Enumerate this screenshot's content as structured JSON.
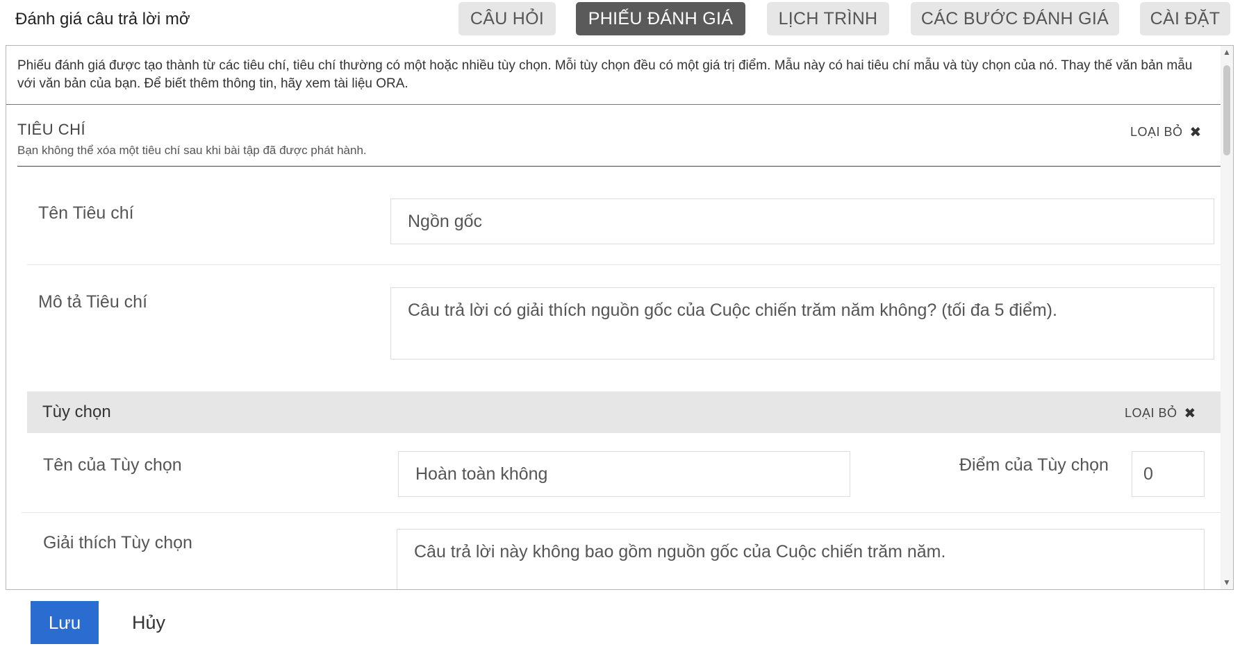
{
  "header": {
    "title": "Đánh giá câu trả lời mở",
    "tabs": [
      {
        "label": "CÂU HỎI",
        "active": false
      },
      {
        "label": "PHIẾU ĐÁNH GIÁ",
        "active": true
      },
      {
        "label": "LỊCH TRÌNH",
        "active": false
      },
      {
        "label": "CÁC BƯỚC ĐÁNH GIÁ",
        "active": false
      },
      {
        "label": "CÀI ĐẶT",
        "active": false
      }
    ]
  },
  "rubric": {
    "intro": "Phiếu đánh giá được tạo thành từ các tiêu chí, tiêu chí thường có một hoặc nhiều tùy chọn. Mỗi tùy chọn đều có một giá trị điểm. Mẫu này có hai tiêu chí mẫu và tùy chọn của nó. Thay thế văn bản mẫu với văn bản của bạn. Để biết thêm thông tin, hãy xem tài liệu ORA.",
    "criterion": {
      "heading": "TIÊU CHÍ",
      "remove_label": "LOẠI BỎ",
      "note": "Bạn không thể xóa một tiêu chí sau khi bài tập đã được phát hành.",
      "name_label": "Tên Tiêu chí",
      "name_value": "Ngồn gốc",
      "desc_label": "Mô tả Tiêu chí",
      "desc_value": "Câu trả lời có giải thích nguồn gốc của Cuộc chiến trăm năm không? (tối đa 5 điểm)."
    },
    "option": {
      "heading": "Tùy chọn",
      "remove_label": "LOẠI BỎ",
      "name_label": "Tên của Tùy chọn",
      "name_value": "Hoàn toàn không",
      "points_label": "Điểm của Tùy chọn",
      "points_value": "0",
      "explanation_label": "Giải thích Tùy chọn",
      "explanation_value": "Câu trả lời này không bao gồm nguồn gốc của Cuộc chiến trăm năm."
    }
  },
  "footer": {
    "save_label": "Lưu",
    "cancel_label": "Hủy"
  },
  "colors": {
    "accent": "#2b6cd1",
    "active_tab": "#5a5a5a",
    "inactive_tab": "#e6e6e6"
  }
}
